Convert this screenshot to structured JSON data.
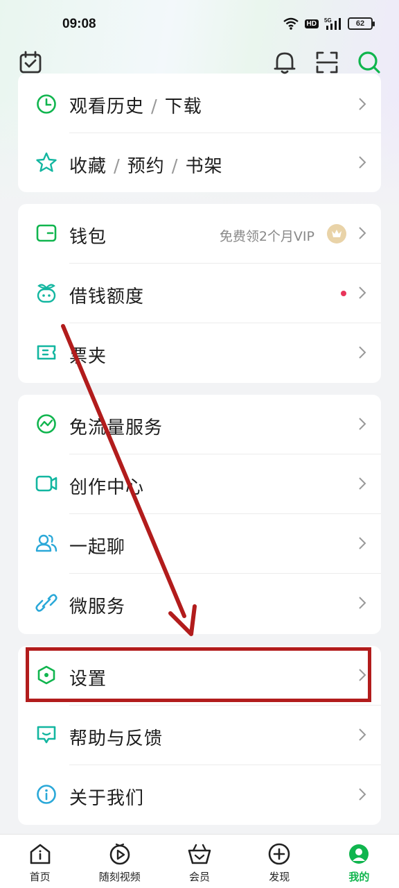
{
  "status_bar": {
    "time": "09:08",
    "network": "5G",
    "hd": "HD",
    "battery": "62"
  },
  "header": {
    "icons": [
      "calendar-check-icon",
      "bell-icon",
      "scan-icon",
      "search-icon"
    ]
  },
  "groups": [
    {
      "items": [
        {
          "icon": "clock-icon",
          "parts": [
            "观看历史",
            "下载"
          ],
          "separator": "/"
        },
        {
          "icon": "star-icon",
          "parts": [
            "收藏",
            "预约",
            "书架"
          ],
          "separator": "/"
        }
      ]
    },
    {
      "items": [
        {
          "icon": "wallet-icon",
          "label": "钱包",
          "right_text": "免费领2个月VIP",
          "badge": "vip-crown-icon"
        },
        {
          "icon": "sprout-icon",
          "label": "借钱额度",
          "dot": true
        },
        {
          "icon": "ticket-icon",
          "label": "票夹"
        }
      ]
    },
    {
      "items": [
        {
          "icon": "traffic-wave-icon",
          "label": "免流量服务"
        },
        {
          "icon": "video-camera-icon",
          "label": "创作中心"
        },
        {
          "icon": "users-icon",
          "label": "一起聊"
        },
        {
          "icon": "link-icon",
          "label": "微服务"
        }
      ]
    },
    {
      "items": [
        {
          "icon": "hexagon-settings-icon",
          "label": "设置"
        },
        {
          "icon": "message-smile-icon",
          "label": "帮助与反馈"
        },
        {
          "icon": "info-icon",
          "label": "关于我们"
        }
      ]
    }
  ],
  "tabbar": {
    "tabs": [
      {
        "label": "首页",
        "icon": "home-icon"
      },
      {
        "label": "随刻视频",
        "icon": "play-circle-icon"
      },
      {
        "label": "会员",
        "icon": "crown-basket-icon"
      },
      {
        "label": "发现",
        "icon": "plus-circle-icon"
      },
      {
        "label": "我的",
        "icon": "profile-icon",
        "active": true
      }
    ]
  },
  "colors": {
    "accent": "#10b54e",
    "annotation": "#b21c1c",
    "dot": "#e8355a"
  }
}
